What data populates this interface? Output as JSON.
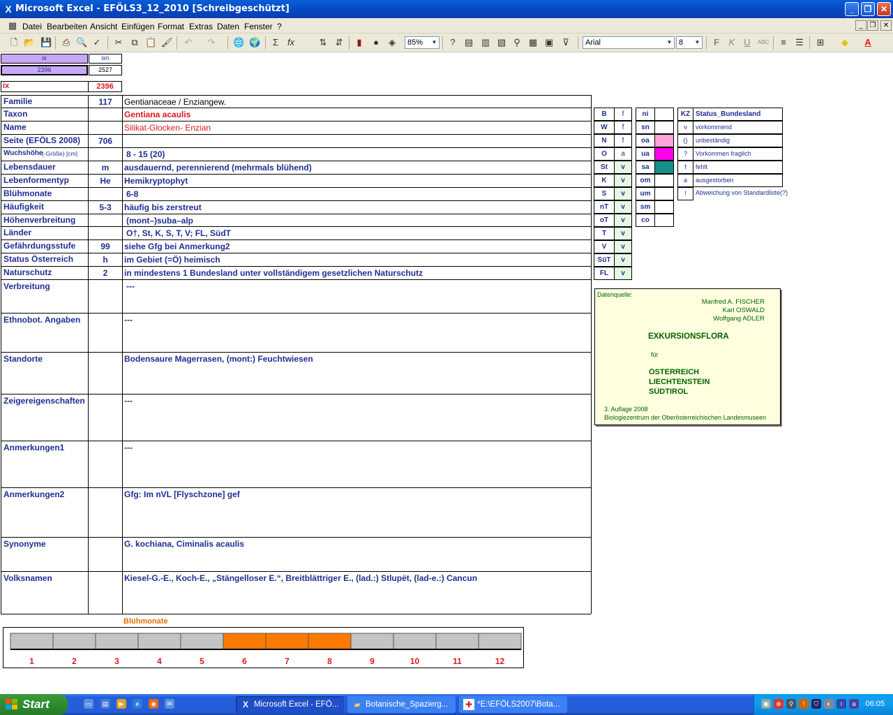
{
  "window": {
    "title": "Microsoft Excel - EFÖLS3_12_2010  [Schreibgeschützt]"
  },
  "menu": [
    "Datei",
    "Bearbeiten",
    "Ansicht",
    "Einfügen",
    "Format",
    "Extras",
    "Daten",
    "Fenster",
    "?"
  ],
  "toolbar": {
    "zoom": "85%",
    "font": "Arial",
    "size": "8"
  },
  "index": {
    "ix_label": "ix",
    "ixn_label": "ixn",
    "ix_value": "2396",
    "ixn_value": "2527",
    "ix2_label": "ix",
    "ix2_value": "2396"
  },
  "rows": [
    {
      "label": "Familie",
      "code": "117",
      "value": "Gentianaceae  /  Enziangew."
    },
    {
      "label": "Taxon",
      "code": "",
      "value": "Gentiana acaulis"
    },
    {
      "label": "Name",
      "code": "",
      "value": "Silikat-Glocken- Enzian"
    },
    {
      "label": "Seite (EFÖLS 2008)",
      "code": "706",
      "value": ""
    },
    {
      "label": "Wuchshöhe",
      "label_suffix": "(-Größe) [cm]",
      "code": "",
      "value": "8 - 15 (20)"
    },
    {
      "label": "Lebensdauer",
      "code": "m",
      "value": "ausdauernd, perennierend (mehrmals blühend)"
    },
    {
      "label": "Lebenformentyp",
      "code": "He",
      "value": "Hemikryptophyt"
    },
    {
      "label": "Blühmonate",
      "code": "",
      "value": "6-8"
    },
    {
      "label": "Häufigkeit",
      "code": "5-3",
      "value": "häufig bis zerstreut"
    },
    {
      "label": "Höhenverbreitung",
      "code": "",
      "value": "(mont–)suba–alp"
    },
    {
      "label": "Länder",
      "code": "",
      "value": "O†, St, K, S, T, V; FL, SüdT"
    },
    {
      "label": "Gefährdungsstufe",
      "code": "99",
      "value": "siehe Gfg bei Anmerkung2"
    },
    {
      "label": "Status Österreich",
      "code": "h",
      "value": "im Gebiet (=Ö) heimisch"
    },
    {
      "label": "Naturschutz",
      "code": "2",
      "value": "in mindestens 1 Bundesland unter vollständigem gesetzlichen Naturschutz"
    }
  ],
  "blocks": [
    {
      "label": "Verbreitung",
      "value": "---"
    },
    {
      "label": "Ethnobot. Angaben",
      "value": "---"
    },
    {
      "label": "Standorte",
      "value": "Bodensaure Magerrasen, (mont:) Feuchtwiesen"
    },
    {
      "label": "Zeigereigenschaften",
      "value": "---"
    },
    {
      "label": "Anmerkungen1",
      "value": "---"
    },
    {
      "label": "Anmerkungen2",
      "value": "Gfg:  Im nVL [Flyschzone] gef"
    },
    {
      "label": "Synonyme",
      "value": "G. kochiana, Ciminalis acaulis"
    },
    {
      "label": "Volksnamen",
      "value": "Kiesel-G.-E., Koch-E., „Stängelloser E.“,   Breitblättriger E., (lad.:) Stlupët, (lad-e.:) Cancun"
    }
  ],
  "states": [
    {
      "code": "B",
      "val": "f"
    },
    {
      "code": "W",
      "val": "f"
    },
    {
      "code": "N",
      "val": "f"
    },
    {
      "code": "O",
      "val": "a"
    },
    {
      "code": "St",
      "val": "v"
    },
    {
      "code": "K",
      "val": "v"
    },
    {
      "code": "S",
      "val": "v"
    },
    {
      "code": "nT",
      "val": "v"
    },
    {
      "code": "oT",
      "val": "v"
    },
    {
      "code": "T",
      "val": "v"
    },
    {
      "code": "V",
      "val": "v"
    },
    {
      "code": "SüT",
      "val": "v"
    },
    {
      "code": "FL",
      "val": "v"
    }
  ],
  "regions": [
    "ni",
    "sn",
    "oa",
    "ua",
    "sa",
    "om",
    "um",
    "sm",
    "co"
  ],
  "region_colors": {
    "oa": "#ffa3d8",
    "ua": "#ff00e8",
    "sa": "#178f8c"
  },
  "status_legend": {
    "header_kz": "KZ",
    "header_title": "Status_Bundesland",
    "items": [
      {
        "kz": "v",
        "text": "vorkommend"
      },
      {
        "kz": "()",
        "text": "unbeständig"
      },
      {
        "kz": "?",
        "text": "Vorkommen fraglich"
      },
      {
        "kz": "f",
        "text": "fehlt"
      },
      {
        "kz": "a",
        "text": "ausgestorben"
      },
      {
        "kz": "!",
        "text": "Abweichung von Standardliste(?)"
      }
    ]
  },
  "datasource": {
    "label": "Datenquelle:",
    "authors": [
      "Manfred A. FISCHER",
      "Karl OSWALD",
      "Wolfgang ADLER"
    ],
    "title": "EXKURSIONSFLORA",
    "fuer": "für",
    "countries": [
      "ÖSTERREICH",
      "LIECHTENSTEIN",
      "SÜDTIROL"
    ],
    "edition": "3. Auflage 2008",
    "publisher": "Biologiezentrum der Oberösterreichischen Landesmuseen"
  },
  "chart_data": {
    "type": "bar",
    "title": "Blühmonate",
    "categories": [
      "1",
      "2",
      "3",
      "4",
      "5",
      "6",
      "7",
      "8",
      "9",
      "10",
      "11",
      "12"
    ],
    "values": [
      0,
      0,
      0,
      0,
      0,
      1,
      1,
      1,
      0,
      0,
      0,
      0
    ],
    "colors": {
      "on": "#ff7a00",
      "off": "#c4c4c4"
    }
  },
  "taskbar": {
    "start": "Start",
    "tasks": [
      "Microsoft Excel - EFÖ...",
      "Botanische_Spazierg...",
      "*E:\\EFÖLS2007\\Bota..."
    ],
    "clock": "06:05"
  }
}
